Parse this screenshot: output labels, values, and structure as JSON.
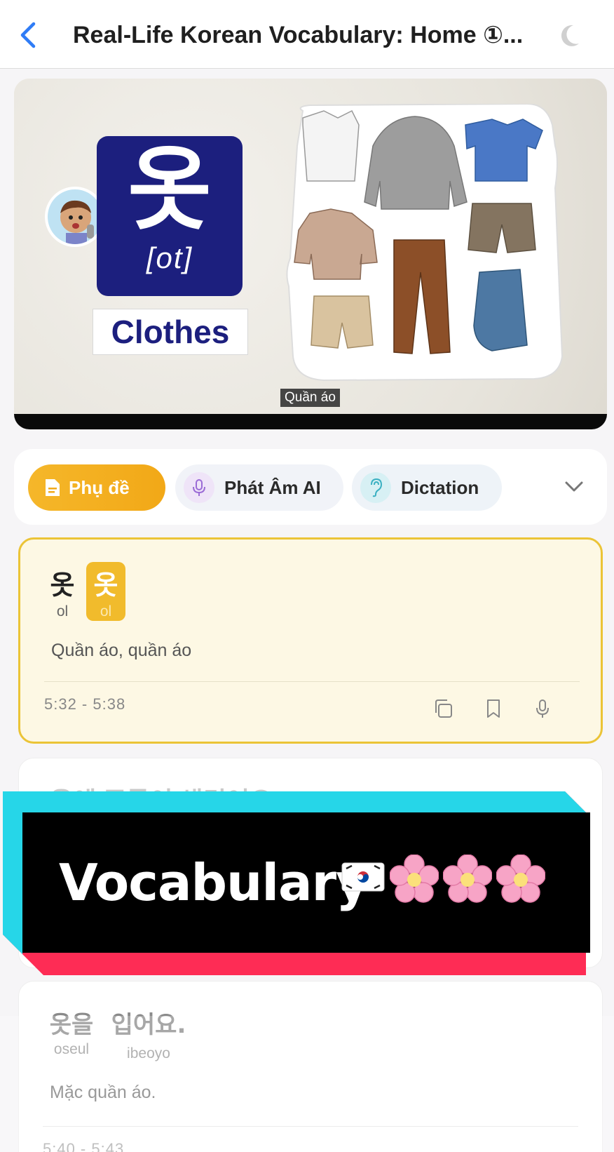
{
  "header": {
    "title": "Real-Life Korean Vocabulary: Home ①..."
  },
  "video": {
    "word_korean": "옷",
    "word_roman": "[ot]",
    "word_english": "Clothes",
    "caption": "Quần áo"
  },
  "tabs": [
    {
      "label": "Phụ đề",
      "icon": "document-icon",
      "active": true
    },
    {
      "label": "Phát Âm AI",
      "icon": "microphone-icon",
      "active": false
    },
    {
      "label": "Dictation",
      "icon": "ear-icon",
      "active": false
    }
  ],
  "cards": [
    {
      "words": [
        {
          "korean": "옷",
          "roman": "ol"
        },
        {
          "korean": "옷",
          "roman": "ol"
        }
      ],
      "meaning": "Quần áo, quần áo",
      "time": "5:32 - 5:38",
      "actions": [
        "copy-icon",
        "bookmark-icon",
        "microphone-icon"
      ]
    },
    {
      "partial_text": "옷에   주름이      생겼어요"
    },
    {
      "words": [
        {
          "korean": "옷을",
          "roman": "oseul"
        },
        {
          "korean": "입어요.",
          "roman": "ibeoyo"
        }
      ],
      "meaning": "Mặc quần áo.",
      "time": "5:40 - 5:43"
    }
  ],
  "overlay_banner": {
    "text": "Vocabulary",
    "emojis": [
      "flag-south-korea",
      "cherry-blossom",
      "cherry-blossom",
      "cherry-blossom"
    ],
    "colors": {
      "cyan": "#26d6e8",
      "red": "#fe2c55",
      "black": "#000000"
    }
  },
  "colors": {
    "accent_yellow": "#f2ab1c",
    "brand_blue": "#1c1f7e",
    "back_blue": "#2f7cf6"
  }
}
